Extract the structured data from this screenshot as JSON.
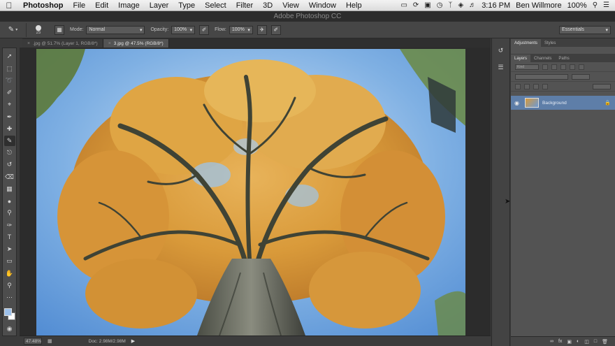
{
  "menubar": {
    "app_name": "Photoshop",
    "menus": [
      "File",
      "Edit",
      "Image",
      "Layer",
      "Type",
      "Select",
      "Filter",
      "3D",
      "View",
      "Window",
      "Help"
    ],
    "time": "3:16 PM",
    "user": "Ben Willmore",
    "battery": "100%"
  },
  "window": {
    "title": "Adobe Photoshop CC"
  },
  "options_bar": {
    "brush_size": "25",
    "mode_label": "Mode:",
    "mode_value": "Normal",
    "opacity_label": "Opacity:",
    "opacity_value": "100%",
    "flow_label": "Flow:",
    "flow_value": "100%",
    "workspace": "Essentials"
  },
  "tabs": [
    {
      "label": ".jpg @ 51.7% (Layer 1, RGB/8*)",
      "active": false
    },
    {
      "label": "3.jpg @ 47.5% (RGB/8*)",
      "active": true
    }
  ],
  "status": {
    "zoom": "47.48%",
    "doc": "Doc: 2.98M/2.98M"
  },
  "panels": {
    "top_tabs": [
      "Adjustments",
      "Styles"
    ],
    "layers_tabs": [
      "Layers",
      "Channels",
      "Paths"
    ],
    "kind_label": "Kind",
    "layer_name": "Background"
  },
  "colors": {
    "foreground": "#9cc0ea",
    "background": "#ffffff",
    "selection": "#5e7ea8"
  }
}
